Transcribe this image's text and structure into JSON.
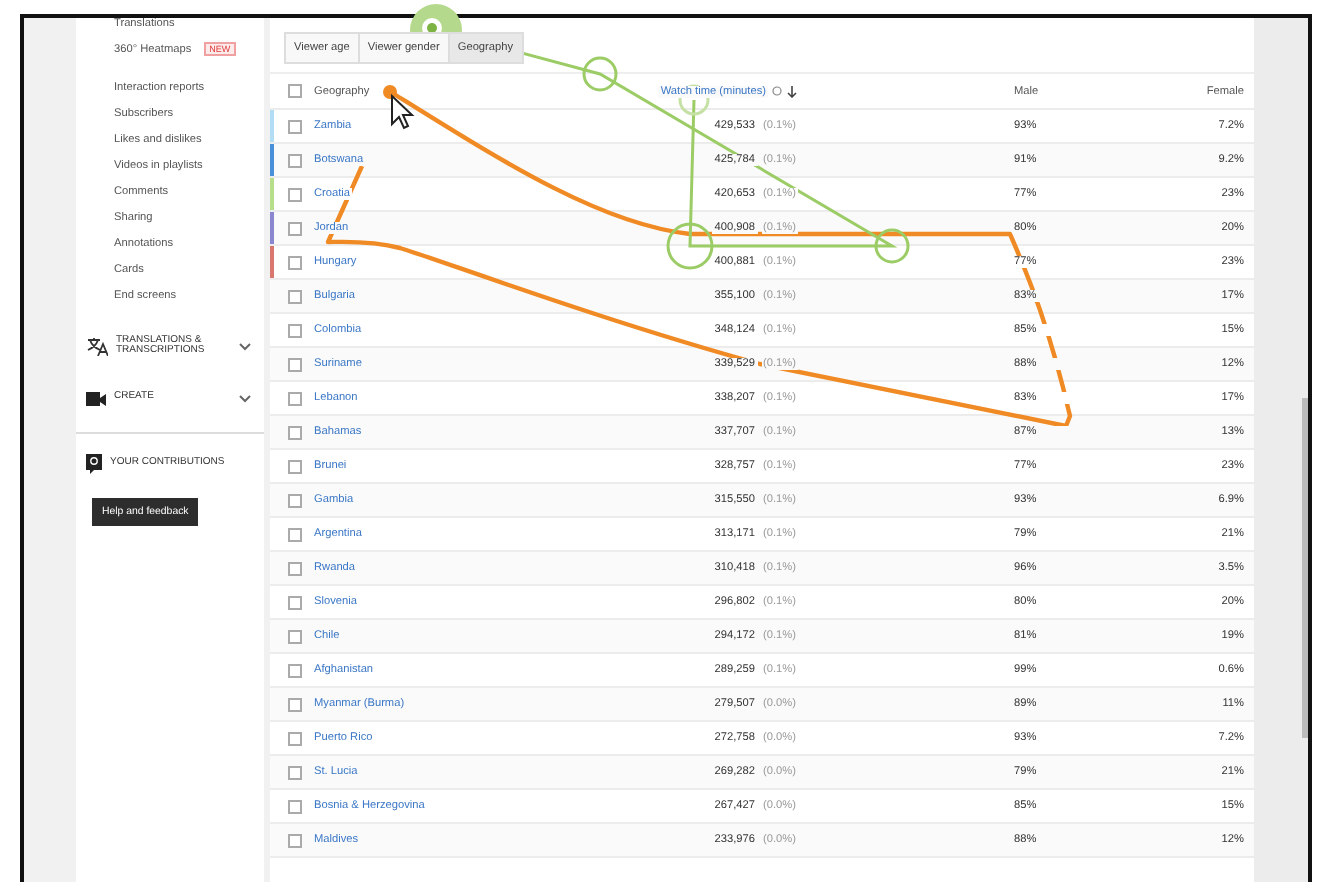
{
  "sidebar": {
    "items": [
      {
        "label": "Translations"
      },
      {
        "label": "360° Heatmaps",
        "badge": "NEW"
      },
      {
        "label": "Interaction reports",
        "kind": "heading"
      },
      {
        "label": "Subscribers"
      },
      {
        "label": "Likes and dislikes"
      },
      {
        "label": "Videos in playlists"
      },
      {
        "label": "Comments"
      },
      {
        "label": "Sharing"
      },
      {
        "label": "Annotations"
      },
      {
        "label": "Cards"
      },
      {
        "label": "End screens"
      }
    ],
    "sections": [
      {
        "label": "TRANSLATIONS & TRANSCRIPTIONS",
        "kind": "translate",
        "expanded": false
      },
      {
        "label": "CREATE",
        "kind": "create",
        "expanded": false
      }
    ],
    "contributions": "YOUR CONTRIBUTIONS",
    "help_button": "Help and feedback"
  },
  "tabs": [
    {
      "label": "Viewer age",
      "selected": false
    },
    {
      "label": "Viewer gender",
      "selected": false
    },
    {
      "label": "Geography",
      "selected": true
    }
  ],
  "table": {
    "header": {
      "checked": false,
      "columns": [
        "Geography",
        "Watch time (minutes)",
        "Male",
        "Female"
      ]
    },
    "rows": [
      {
        "name": "Zambia",
        "watch_time": "429,533",
        "share": "(0.1%)",
        "male": "93%",
        "female": "7.2%",
        "checked": false,
        "color": "#b3dcf5"
      },
      {
        "name": "Botswana",
        "watch_time": "425,784",
        "share": "(0.1%)",
        "male": "91%",
        "female": "9.2%",
        "checked": false,
        "color": "#4a90d9"
      },
      {
        "name": "Croatia",
        "watch_time": "420,653",
        "share": "(0.1%)",
        "male": "77%",
        "female": "23%",
        "checked": false,
        "color": "#b5df8a"
      },
      {
        "name": "Jordan",
        "watch_time": "400,908",
        "share": "(0.1%)",
        "male": "80%",
        "female": "20%",
        "checked": false,
        "color": "#8a86cf"
      },
      {
        "name": "Hungary",
        "watch_time": "400,881",
        "share": "(0.1%)",
        "male": "77%",
        "female": "23%",
        "checked": false,
        "color": "#d9776f"
      },
      {
        "name": "Bulgaria",
        "watch_time": "355,100",
        "share": "(0.1%)",
        "male": "83%",
        "female": "17%",
        "checked": false
      },
      {
        "name": "Colombia",
        "watch_time": "348,124",
        "share": "(0.1%)",
        "male": "85%",
        "female": "15%",
        "checked": false
      },
      {
        "name": "Suriname",
        "watch_time": "339,529",
        "share": "(0.1%)",
        "male": "88%",
        "female": "12%",
        "checked": false
      },
      {
        "name": "Lebanon",
        "watch_time": "338,207",
        "share": "(0.1%)",
        "male": "83%",
        "female": "17%",
        "checked": false
      },
      {
        "name": "Bahamas",
        "watch_time": "337,707",
        "share": "(0.1%)",
        "male": "87%",
        "female": "13%",
        "checked": false
      },
      {
        "name": "Brunei",
        "watch_time": "328,757",
        "share": "(0.1%)",
        "male": "77%",
        "female": "23%",
        "checked": false
      },
      {
        "name": "Gambia",
        "watch_time": "315,550",
        "share": "(0.1%)",
        "male": "93%",
        "female": "6.9%",
        "checked": false
      },
      {
        "name": "Argentina",
        "watch_time": "313,171",
        "share": "(0.1%)",
        "male": "79%",
        "female": "21%",
        "checked": false
      },
      {
        "name": "Rwanda",
        "watch_time": "310,418",
        "share": "(0.1%)",
        "male": "96%",
        "female": "3.5%",
        "checked": false
      },
      {
        "name": "Slovenia",
        "watch_time": "296,802",
        "share": "(0.1%)",
        "male": "80%",
        "female": "20%",
        "checked": false
      },
      {
        "name": "Chile",
        "watch_time": "294,172",
        "share": "(0.1%)",
        "male": "81%",
        "female": "19%",
        "checked": false
      },
      {
        "name": "Afghanistan",
        "watch_time": "289,259",
        "share": "(0.1%)",
        "male": "99%",
        "female": "0.6%",
        "checked": false
      },
      {
        "name": "Myanmar (Burma)",
        "watch_time": "279,507",
        "share": "(0.0%)",
        "male": "89%",
        "female": "11%",
        "checked": false
      },
      {
        "name": "Puerto Rico",
        "watch_time": "272,758",
        "share": "(0.0%)",
        "male": "93%",
        "female": "7.2%",
        "checked": false
      },
      {
        "name": "St. Lucia",
        "watch_time": "269,282",
        "share": "(0.0%)",
        "male": "79%",
        "female": "21%",
        "checked": false
      },
      {
        "name": "Bosnia & Herzegovina",
        "watch_time": "267,427",
        "share": "(0.0%)",
        "male": "85%",
        "female": "15%",
        "checked": false
      },
      {
        "name": "Maldives",
        "watch_time": "233,976",
        "share": "(0.0%)",
        "male": "88%",
        "female": "12%",
        "checked": false
      }
    ]
  }
}
